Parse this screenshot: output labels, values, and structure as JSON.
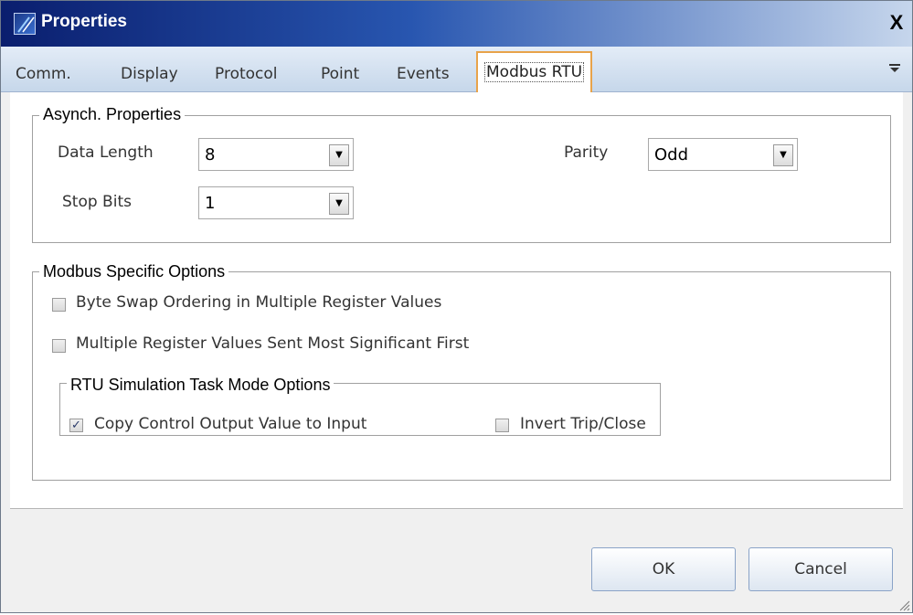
{
  "window": {
    "title": "Properties",
    "close_glyph": "X"
  },
  "tabs": [
    {
      "label": "Comm."
    },
    {
      "label": "Display"
    },
    {
      "label": "Protocol"
    },
    {
      "label": "Point"
    },
    {
      "label": "Events"
    },
    {
      "label": "Modbus RTU",
      "active": true
    }
  ],
  "tab_overflow_icon": "chevron-down-icon",
  "asynch": {
    "title": "Asynch. Properties",
    "data_length_label": "Data Length",
    "data_length_value": "8",
    "stop_bits_label": "Stop Bits",
    "stop_bits_value": "1",
    "parity_label": "Parity",
    "parity_value": "Odd"
  },
  "modbus": {
    "title": "Modbus Specific Options",
    "byte_swap": {
      "label": "Byte Swap Ordering in Multiple Register Values",
      "checked": false
    },
    "msf": {
      "label": "Multiple Register Values Sent Most Significant First",
      "checked": false
    },
    "rtu_sim": {
      "title": "RTU Simulation Task Mode Options",
      "copy_control": {
        "label": "Copy Control Output Value to Input",
        "checked": true
      },
      "invert_trip": {
        "label": "Invert Trip/Close",
        "checked": false
      }
    }
  },
  "buttons": {
    "ok": "OK",
    "cancel": "Cancel"
  },
  "colors": {
    "accent": "#e8a34a",
    "titlebar": "#0a1e6e"
  }
}
